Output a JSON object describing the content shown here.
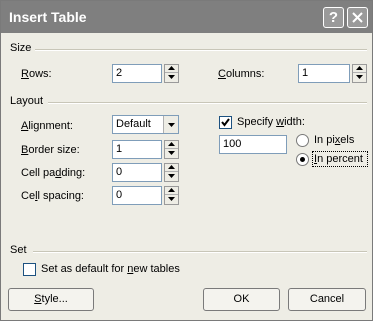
{
  "window": {
    "title": "Insert Table"
  },
  "titlebar": {
    "help_glyph": "?",
    "close_icon": "close-x-icon"
  },
  "size": {
    "label": "Size",
    "rows": {
      "label_pre": "",
      "label_key": "R",
      "label_post": "ows:",
      "value": "2"
    },
    "columns": {
      "label_pre": "",
      "label_key": "C",
      "label_post": "olumns:",
      "value": "1"
    }
  },
  "layout": {
    "label": "Layout",
    "alignment": {
      "label_pre": "",
      "label_key": "A",
      "label_post": "lignment:",
      "value": "Default"
    },
    "border_size": {
      "label_pre": "",
      "label_key": "B",
      "label_post": "order size:",
      "value": "1"
    },
    "cell_padding": {
      "label_pre": "Cell pa",
      "label_key": "d",
      "label_post": "ding:",
      "value": "0"
    },
    "cell_spacing": {
      "label_pre": "Ce",
      "label_key": "l",
      "label_post": "l spacing:",
      "value": "0"
    },
    "specify_width": {
      "label_pre": "Specify ",
      "label_key": "w",
      "label_post": "idth:",
      "checked": true,
      "value": "100"
    },
    "in_pixels": {
      "label_pre": "In pi",
      "label_key": "x",
      "label_post": "els",
      "selected": false
    },
    "in_percent": {
      "label_pre": "",
      "label_key": "I",
      "label_post": "n percent",
      "selected": true
    }
  },
  "set": {
    "label": "Set",
    "default_check": {
      "label_pre": "Set as default for ",
      "label_key": "n",
      "label_post": "ew tables",
      "checked": false
    }
  },
  "buttons": {
    "style": {
      "label_pre": "",
      "label_key": "S",
      "label_post": "tyle..."
    },
    "ok": "OK",
    "cancel": "Cancel"
  },
  "colors": {
    "titlebar": "#7f7f7f",
    "dialog": "#eeede5",
    "field_border": "#7f9db9"
  }
}
